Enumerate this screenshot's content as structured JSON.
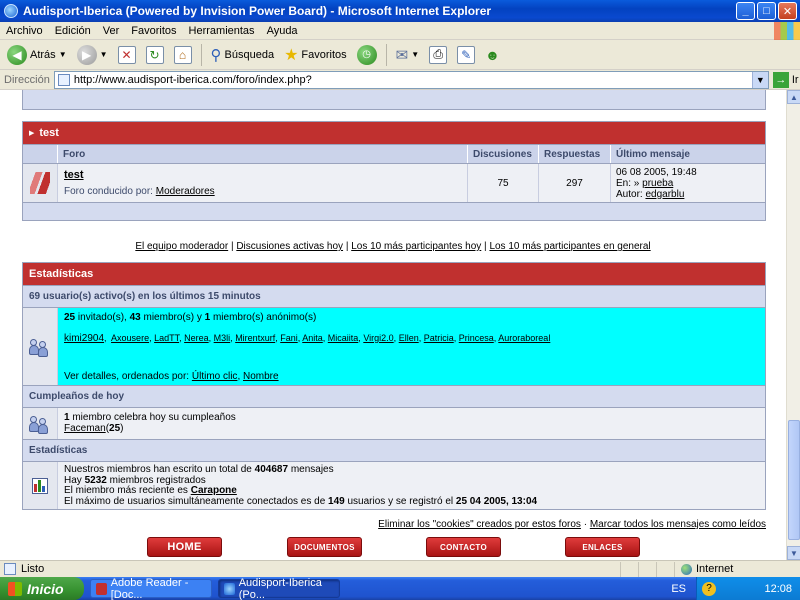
{
  "window": {
    "title": "Audisport-Iberica (Powered by Invision Power Board) - Microsoft Internet Explorer",
    "min": "_",
    "max": "□",
    "close": "✕"
  },
  "menu": [
    "Archivo",
    "Edición",
    "Ver",
    "Favoritos",
    "Herramientas",
    "Ayuda"
  ],
  "toolbar": {
    "back": "Atrás",
    "search": "Búsqueda",
    "favorites": "Favoritos"
  },
  "address": {
    "label": "Dirección",
    "url": "http://www.audisport-iberica.com/foro/index.php?",
    "go": "Ir"
  },
  "category": {
    "name": "test",
    "columns": [
      "Foro",
      "Discusiones",
      "Respuestas",
      "Último mensaje"
    ],
    "forum": {
      "name": "test",
      "moderated_by_label": "Foro conducido por:",
      "moderator": "Moderadores",
      "topics": "75",
      "replies": "297",
      "last_date": "06 08 2005, 19:48",
      "last_in_label": "En:",
      "last_in": "prueba",
      "last_author_label": "Autor:",
      "last_author": "edgarblu"
    }
  },
  "links": {
    "mod_team": "El equipo moderador",
    "active_topics": "Discusiones activas hoy",
    "top10_today": "Los 10 más participantes hoy",
    "top10_all": "Los 10 más participantes en general"
  },
  "stats": {
    "header": "Estadísticas",
    "active_title": "69 usuario(s) activo(s) en los últimos 15 minutos",
    "active_line": {
      "guests": "25",
      "guests_label": "invitado(s),",
      "members": "43",
      "members_label": "miembro(s) y",
      "anon": "1",
      "anon_label": "miembro(s) anónimo(s)"
    },
    "users": [
      "kimi2904",
      "Axousere",
      "LadTT",
      "Nerea",
      "M3li",
      "Mirentxurf",
      "Fani",
      "Anita",
      "Micaiita",
      "Virgi2.0",
      "Ellen",
      "Patricia",
      "Princesa",
      "Auroraboreal"
    ],
    "details_label": "Ver detalles, ordenados por:",
    "sort_last_click": "Último clic",
    "sort_name": "Nombre",
    "birthdays_title": "Cumpleaños de hoy",
    "birthday_count": "1",
    "birthday_text": "miembro celebra hoy su cumpleaños",
    "birthday_user": "Faceman",
    "birthday_age": "25",
    "stats_title": "Estadísticas",
    "posts_text": "Nuestros miembros han escrito un total de",
    "posts_count": "404687",
    "posts_unit": "mensajes",
    "members_pre": "Hay",
    "members_count": "5232",
    "members_text": "miembros registrados",
    "newest_text": "El miembro más reciente es",
    "newest_member": "Carapone",
    "max_pre": "El máximo de usuarios simultáneamente conectados es de",
    "max_users": "149",
    "max_mid": "usuarios y se registró el",
    "max_date": "25 04 2005, 13:04"
  },
  "footer": {
    "delete_cookies": "Eliminar los \"cookies\" creados por estos foros",
    "mark_read": "Marcar todos los mensajes como leídos"
  },
  "nav": [
    "HOME",
    "DOCUMENTOS",
    "CONTACTO",
    "ENLACES"
  ],
  "status": {
    "text": "Listo",
    "zone": "Internet"
  },
  "taskbar": {
    "start": "Inicio",
    "task1": "Adobe Reader - [Doc...",
    "task2": "Audisport-Iberica (Po...",
    "lang": "ES",
    "time": "12:08"
  },
  "colors": {
    "accent_red": "#c0302f",
    "cyan_highlight": "#00ffff",
    "band": "#d4dbef"
  }
}
